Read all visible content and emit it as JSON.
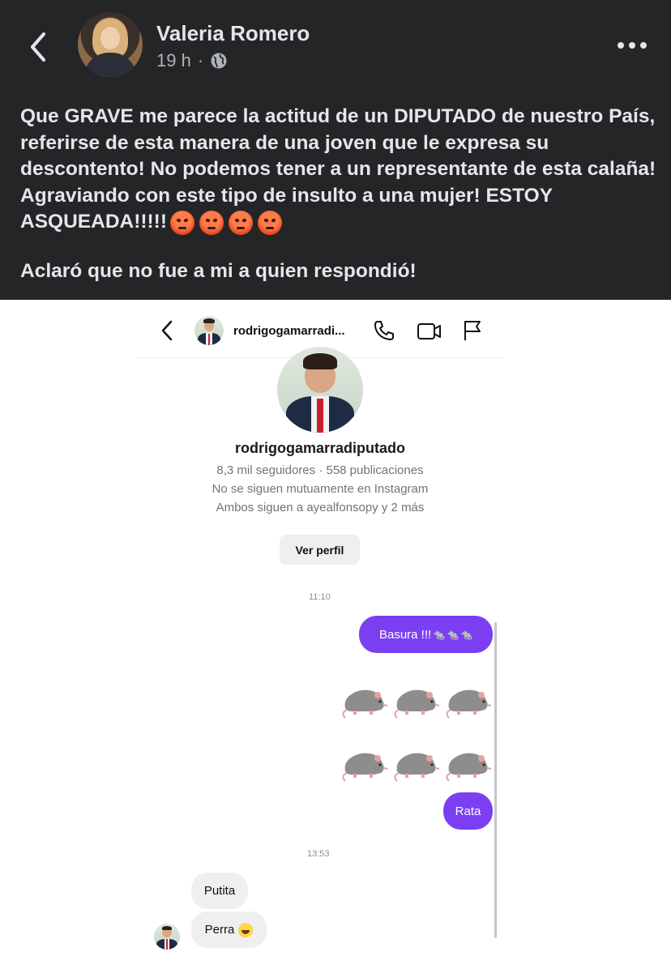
{
  "post": {
    "author": "Valeria Romero",
    "time": "19 h",
    "separator": "·",
    "icons": {
      "back": "back-chevron-icon",
      "audience": "globe-icon",
      "more": "more-options-icon"
    },
    "text_main": "Que GRAVE me parece la actitud de un DIPUTADO de nuestro País, referirse de esta manera de una joven que le expresa su descontento! No podemos tener a un representante de esta calaña! Agraviando con este tipo de insulto a una mujer! ESTOY ASQUEADA!!!!!",
    "emojis": [
      "angry-face-icon",
      "angry-face-icon",
      "angry-face-icon",
      "angry-face-icon"
    ],
    "text_second": "Aclaró que no fue a mi a quien respondió!",
    "colors": {
      "background": "#242526",
      "text": "#e4e6eb",
      "muted": "#b0b3b8"
    }
  },
  "instagram": {
    "header": {
      "username_truncated": "rodrigogamarradi...",
      "icons": [
        "back-chevron-icon",
        "phone-icon",
        "video-camera-icon",
        "flag-icon"
      ]
    },
    "profile": {
      "username": "rodrigogamarradiputado",
      "stats": "8,3 mil seguidores · 558 publicaciones",
      "mutual": "No se siguen mutuamente en Instagram",
      "common": "Ambos siguen a ayealfonsopy y 2 más",
      "view_profile_label": "Ver perfil"
    },
    "messages": {
      "timestamp_1": "11:10",
      "outgoing_1": "Basura !!!",
      "outgoing_1_emojis": [
        "rat-icon",
        "rat-icon",
        "rat-icon"
      ],
      "rat_rows": [
        [
          "rat-icon",
          "rat-icon",
          "rat-icon"
        ],
        [
          "rat-icon",
          "rat-icon",
          "rat-icon"
        ]
      ],
      "outgoing_2": "Rata",
      "timestamp_2": "13:53",
      "incoming_1": "Putita",
      "incoming_2": "Perra",
      "incoming_2_emoji": "laughing-face-icon"
    },
    "colors": {
      "outgoing_bubble": "#7b3ff2",
      "incoming_bubble": "#efefef",
      "muted": "#737373"
    }
  }
}
